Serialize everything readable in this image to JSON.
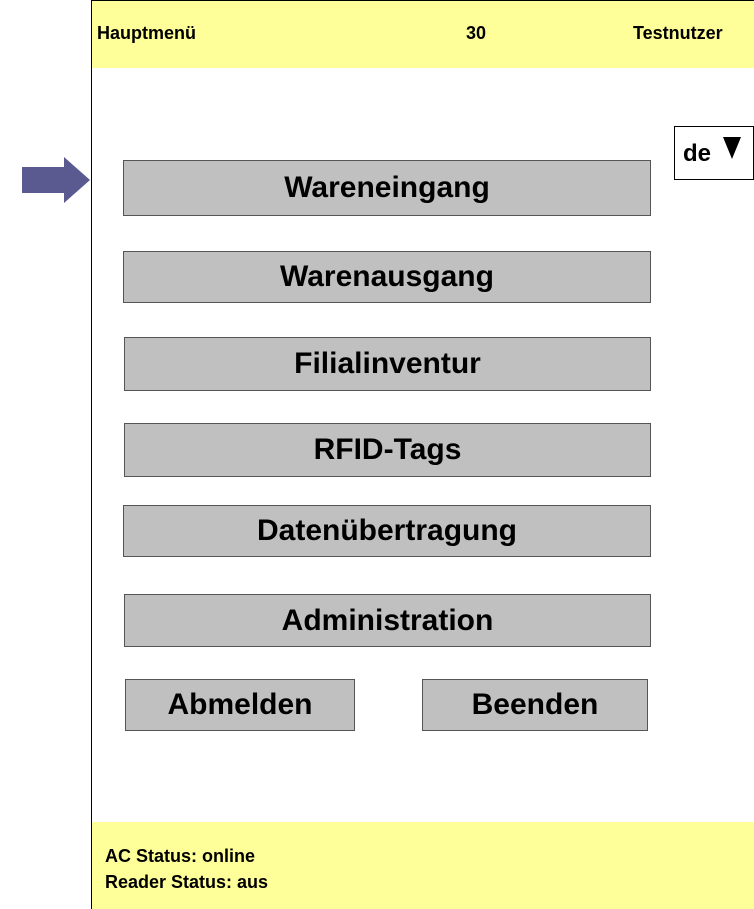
{
  "header": {
    "title": "Hauptmenü",
    "count": "30",
    "user": "Testnutzer"
  },
  "language": {
    "code": "de",
    "icon": "triangle-down-icon"
  },
  "menu": {
    "items": [
      {
        "label": "Wareneingang"
      },
      {
        "label": "Warenausgang"
      },
      {
        "label": "Filialinventur"
      },
      {
        "label": "RFID-Tags"
      },
      {
        "label": "Datenübertragung"
      },
      {
        "label": "Administration"
      }
    ],
    "logout_label": "Abmelden",
    "exit_label": "Beenden"
  },
  "status": {
    "ac": "AC Status: online",
    "reader": "Reader Status: aus"
  },
  "colors": {
    "header_bg": "#ffff99",
    "button_bg": "#c0c0c0",
    "pointer": "#5a5a91"
  },
  "pointer": {
    "icon": "right-arrow-icon"
  }
}
